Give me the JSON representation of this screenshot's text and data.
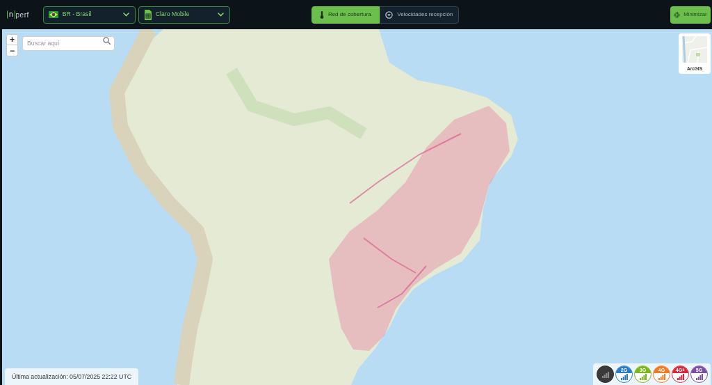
{
  "header": {
    "logo": {
      "mark": "n",
      "text": "perf"
    },
    "selects": [
      {
        "kind": "country",
        "value": "BR - Brasil"
      },
      {
        "kind": "operator",
        "value": "Claro Mobile"
      }
    ],
    "view_tabs": [
      {
        "kind": "coverage",
        "label": "Red de cobertura",
        "selected": true
      },
      {
        "kind": "speed",
        "label": "Velocidades recepción",
        "selected": false
      }
    ],
    "minimize_button": "Minimizar"
  },
  "map": {
    "zoom_in": "+",
    "zoom_out": "−",
    "search": {
      "placeholder": "Buscar aquí"
    },
    "basemap": {
      "label": "ArcGIS"
    },
    "last_update": "Última actualización: 05/07/2025 22:22 UTC",
    "technologies": [
      {
        "kind": "all"
      },
      {
        "kind": "tech",
        "label": "2G",
        "color": "#2b7cc4"
      },
      {
        "kind": "tech",
        "label": "3G",
        "color": "#7ab51d"
      },
      {
        "kind": "tech",
        "label": "4G",
        "color": "#f07a22"
      },
      {
        "kind": "tech",
        "label": "4G+",
        "color": "#d9263a"
      },
      {
        "kind": "tech",
        "label": "5G",
        "color": "#7b4fa8"
      }
    ]
  }
}
